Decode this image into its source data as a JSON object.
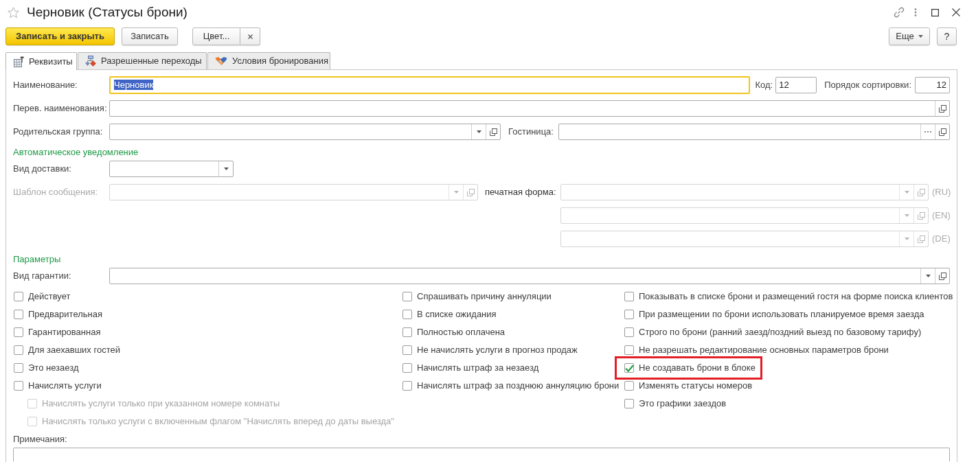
{
  "window": {
    "title": "Черновик (Статусы брони)",
    "favorite": false
  },
  "toolbar": {
    "save_close": "Записать и закрыть",
    "save": "Записать",
    "color_picker": "Цвет...",
    "more": "Еще",
    "help": "?"
  },
  "tabs": [
    {
      "label": "Реквизиты",
      "selected": true
    },
    {
      "label": "Разрешенные переходы",
      "selected": false
    },
    {
      "label": "Условия бронирования",
      "selected": false
    }
  ],
  "main": {
    "name": {
      "label": "Наименование:",
      "value": "Черновик",
      "focused": true,
      "value_selected": true
    },
    "code": {
      "label": "Код:",
      "value": "12"
    },
    "sort_order": {
      "label": "Порядок сортировки:",
      "value": "12"
    },
    "translated_name": {
      "label": "Перев. наименования:"
    },
    "parent_group": {
      "label": "Родительская группа:"
    },
    "hotel": {
      "label": "Гостиница:"
    }
  },
  "notification": {
    "heading": "Автоматическое уведомление",
    "delivery_type": {
      "label": "Вид доставки:"
    },
    "message_template": {
      "label": "Шаблон сообщения:",
      "disabled": true
    },
    "print_form": {
      "label": "печатная форма:",
      "languages": [
        {
          "code": "(RU)",
          "disabled": true
        },
        {
          "code": "(EN)",
          "disabled": true
        },
        {
          "code": "(DE)",
          "disabled": true
        }
      ]
    }
  },
  "parameters": {
    "heading": "Параметры",
    "guarantee_type": {
      "label": "Вид гарантии:"
    },
    "flag_columns": [
      [
        {
          "label": "Действует",
          "checked": false,
          "disabled": false,
          "highlighted": false
        },
        {
          "label": "Предварительная",
          "checked": false,
          "disabled": false,
          "highlighted": false
        },
        {
          "label": "Гарантированная",
          "checked": false,
          "disabled": false,
          "highlighted": false
        },
        {
          "label": "Для заехавших гостей",
          "checked": false,
          "disabled": false,
          "highlighted": false
        },
        {
          "label": "Это незаезд",
          "checked": false,
          "disabled": false,
          "highlighted": false
        },
        {
          "label": "Начислять услуги",
          "checked": false,
          "disabled": false,
          "highlighted": false,
          "children": [
            {
              "label": "Начислять услуги только при указанном номере комнаты",
              "checked": false,
              "disabled": true,
              "highlighted": false
            },
            {
              "label": "Начислять только услуги с включенным флагом \"Начислять вперед до даты выезда\"",
              "checked": false,
              "disabled": true,
              "highlighted": false
            }
          ]
        }
      ],
      [
        {
          "label": "Спрашивать причину аннуляции",
          "checked": false,
          "disabled": false,
          "highlighted": false
        },
        {
          "label": "В списке ожидания",
          "checked": false,
          "disabled": false,
          "highlighted": false
        },
        {
          "label": "Полностью оплачена",
          "checked": false,
          "disabled": false,
          "highlighted": false
        },
        {
          "label": "Не начислять услуги в прогноз продаж",
          "checked": false,
          "disabled": false,
          "highlighted": false
        },
        {
          "label": "Начислять штраф за незаезд",
          "checked": false,
          "disabled": false,
          "highlighted": false
        },
        {
          "label": "Начислять штраф за позднюю аннуляцию брони",
          "checked": false,
          "disabled": false,
          "highlighted": false
        }
      ],
      [
        {
          "label": "Показывать в списке брони и размещений гостя на форме поиска клиентов",
          "checked": false,
          "disabled": false,
          "highlighted": false
        },
        {
          "label": "При размещении по брони использовать планируемое время заезда",
          "checked": false,
          "disabled": false,
          "highlighted": false
        },
        {
          "label": "Строго по брони (ранний заезд/поздний выезд по базовому тарифу)",
          "checked": false,
          "disabled": false,
          "highlighted": false
        },
        {
          "label": "Не разрешать редактирование основных параметров брони",
          "checked": false,
          "disabled": false,
          "highlighted": false
        },
        {
          "label": "Не создавать брони в блоке",
          "checked": true,
          "disabled": false,
          "highlighted": true
        },
        {
          "label": "Изменять статусы номеров",
          "checked": false,
          "disabled": false,
          "highlighted": false
        },
        {
          "label": "Это графики заездов",
          "checked": false,
          "disabled": false,
          "highlighted": false
        }
      ]
    ]
  },
  "notes": {
    "label": "Примечания:"
  }
}
